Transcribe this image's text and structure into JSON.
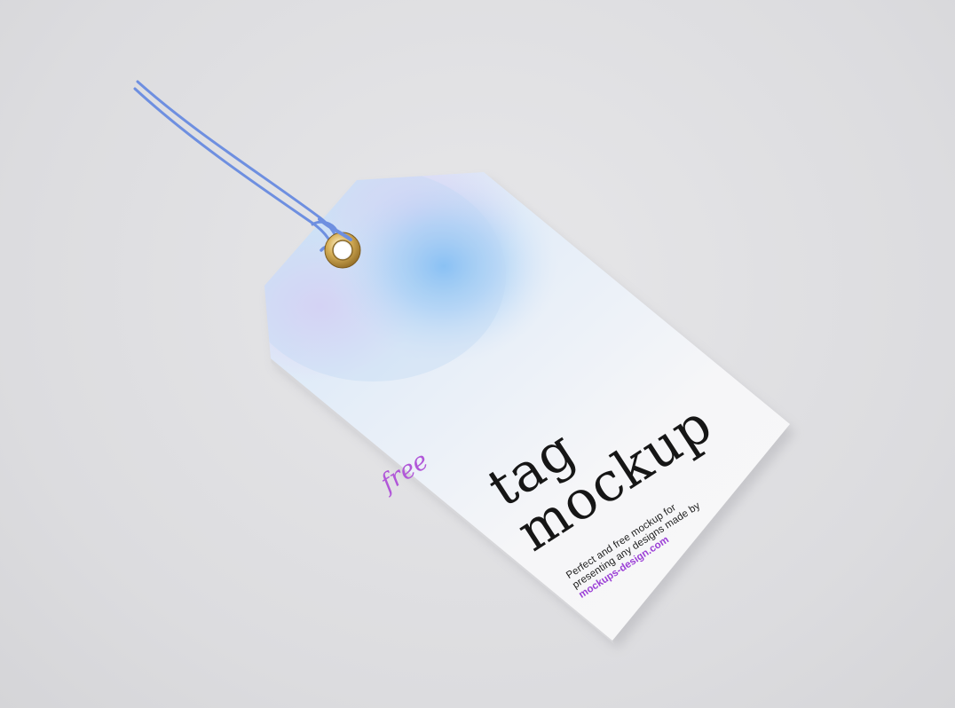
{
  "tag": {
    "free_label": "free",
    "title_line_1": "tag",
    "title_line_2": "mockup",
    "description_line_1": "Perfect and free mockup for",
    "description_line_2": "presenting any designs made by",
    "link": "mockups-design.com"
  },
  "colors": {
    "background": "#dcdcdf",
    "card": "#f7f7f8",
    "gradient_blue": "#6fb6f2",
    "gradient_lilac": "#e4d6f5",
    "string": "#6e8fe0",
    "eyelet": "#c9a24a",
    "accent_purple": "#9b3fd6",
    "title_text": "#161616"
  }
}
